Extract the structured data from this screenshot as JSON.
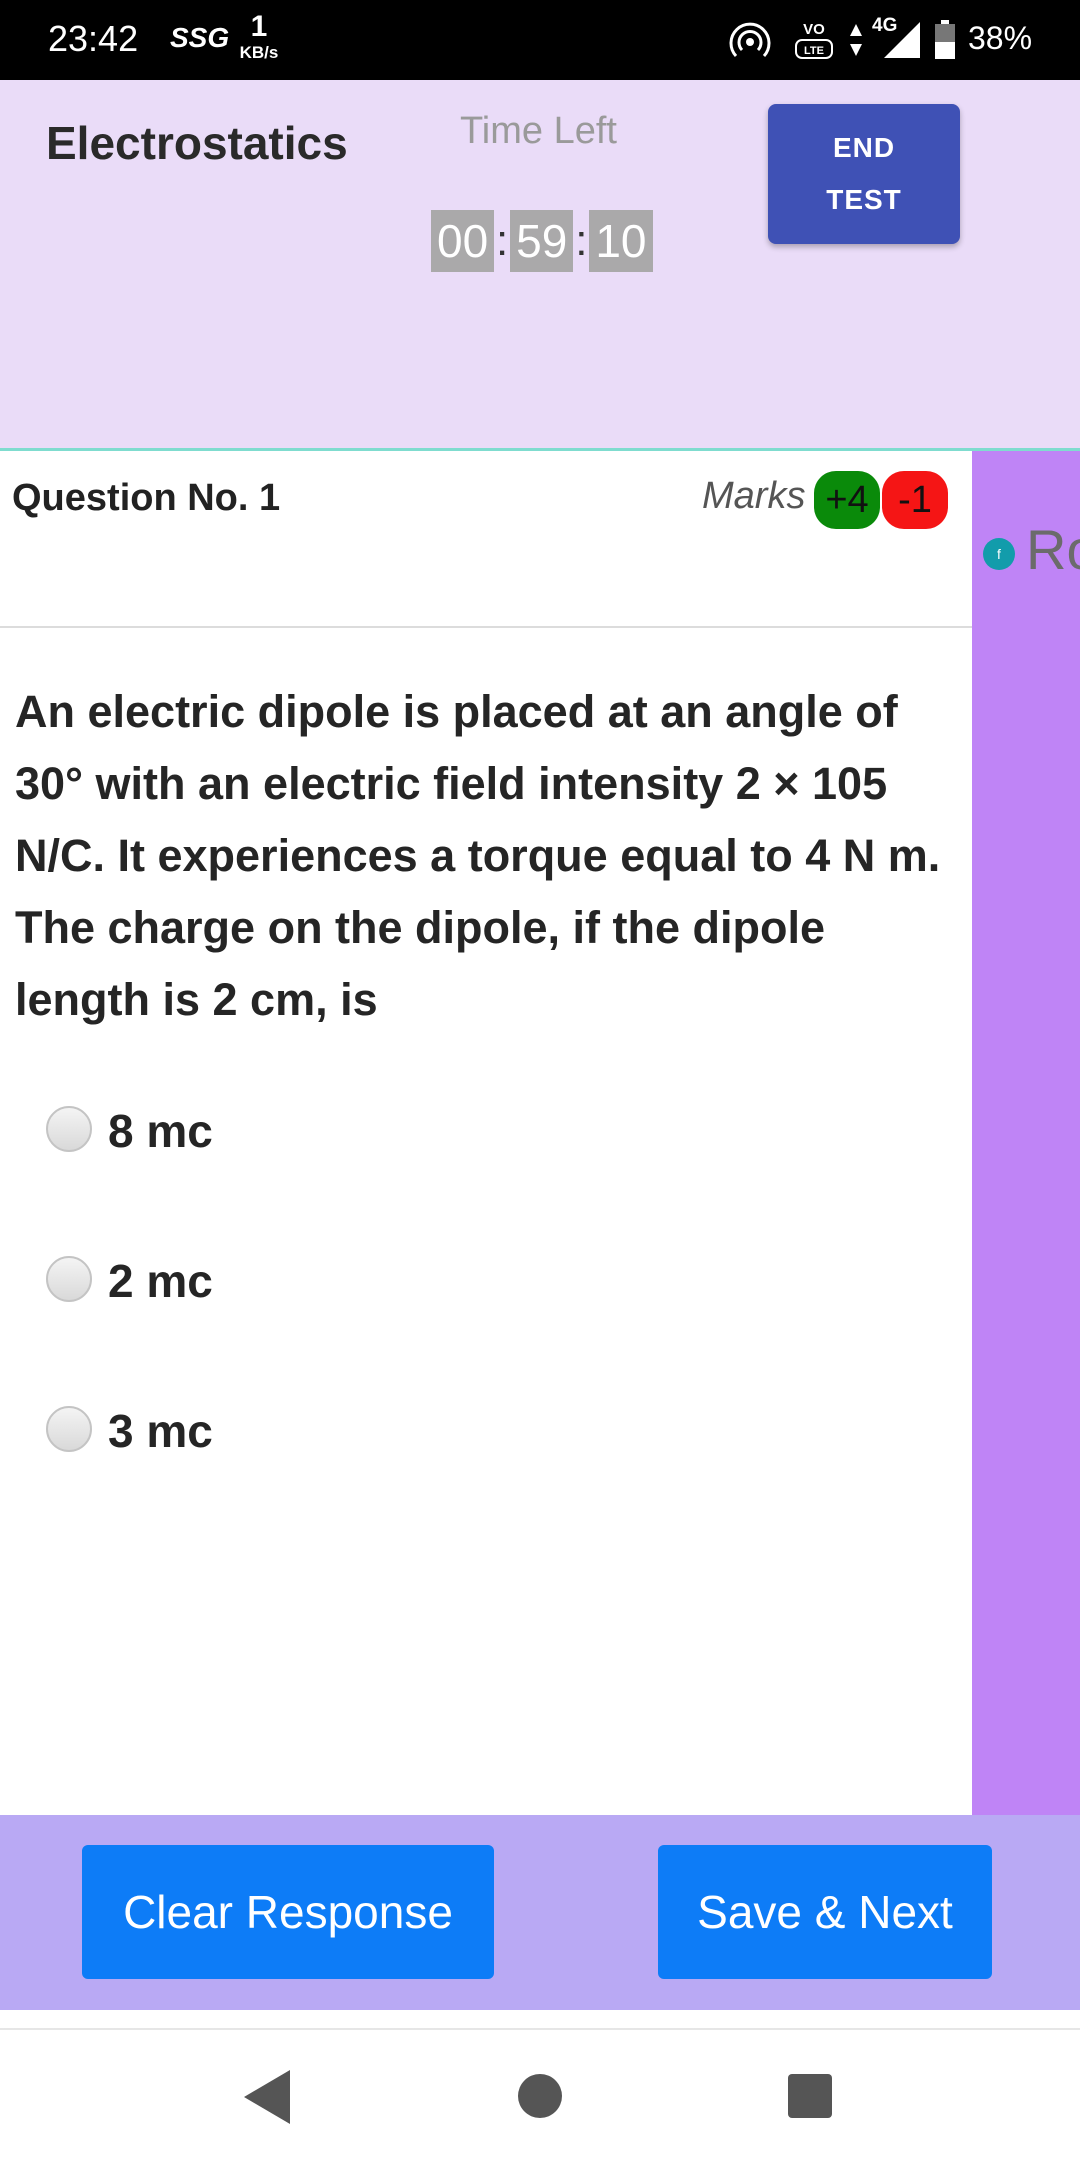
{
  "status_bar": {
    "time": "23:42",
    "carrier": "SSG",
    "speed_value": "1",
    "speed_unit": "KB/s",
    "network": "4G",
    "battery": "38%"
  },
  "header": {
    "subject": "Electrostatics",
    "time_left_label": "Time Left",
    "timer": {
      "hours": "00",
      "minutes": "59",
      "seconds": "10",
      "separator": ":"
    },
    "end_test_line1": "END",
    "end_test_line2": "TEST"
  },
  "side_panel": {
    "dot_label": "f",
    "partial_text": "Ro"
  },
  "question": {
    "number_label": "Question No. 1",
    "marks_label": "Marks",
    "positive_marks": "+4",
    "negative_marks": "-1",
    "text": "An electric dipole is placed at an angle of 30° with an electric field intensity 2 × 105 N/C. It experiences a torque equal to 4 N m. The charge on the dipole, if the dipole length is 2 cm, is",
    "options": [
      "8 mc",
      "2 mc",
      "3 mc"
    ]
  },
  "actions": {
    "clear_label": "Clear Response",
    "save_next_label": "Save & Next"
  },
  "colors": {
    "header_bg": "#eadcf8",
    "end_test_bg": "#3f51b5",
    "side_panel_bg": "#bf84f6",
    "action_bar_bg": "#b9a9f4",
    "button_bg": "#0d7cf7",
    "positive_badge": "#0a8a0a",
    "negative_badge": "#f51515"
  }
}
